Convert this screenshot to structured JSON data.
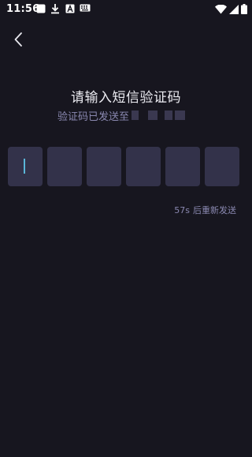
{
  "status_bar": {
    "time": "11:56",
    "icons": [
      "square-notification-icon",
      "download-icon",
      "text-a-icon",
      "keyboard-icon",
      "wifi-icon",
      "cellular-signal-icon",
      "battery-icon"
    ]
  },
  "header": {
    "back_icon": "chevron-left-icon"
  },
  "main": {
    "title": "请输入短信验证码",
    "subtitle": "验证码已发送至"
  },
  "code_input": {
    "box_count": 6,
    "values": [
      "",
      "",
      "",
      "",
      "",
      ""
    ]
  },
  "resend": {
    "countdown": "57s",
    "label": "后重新发送"
  },
  "colors": {
    "background": "#17161f",
    "box": "#33324a",
    "cursor": "#5ab6d8",
    "muted_text": "#8a88b0"
  }
}
